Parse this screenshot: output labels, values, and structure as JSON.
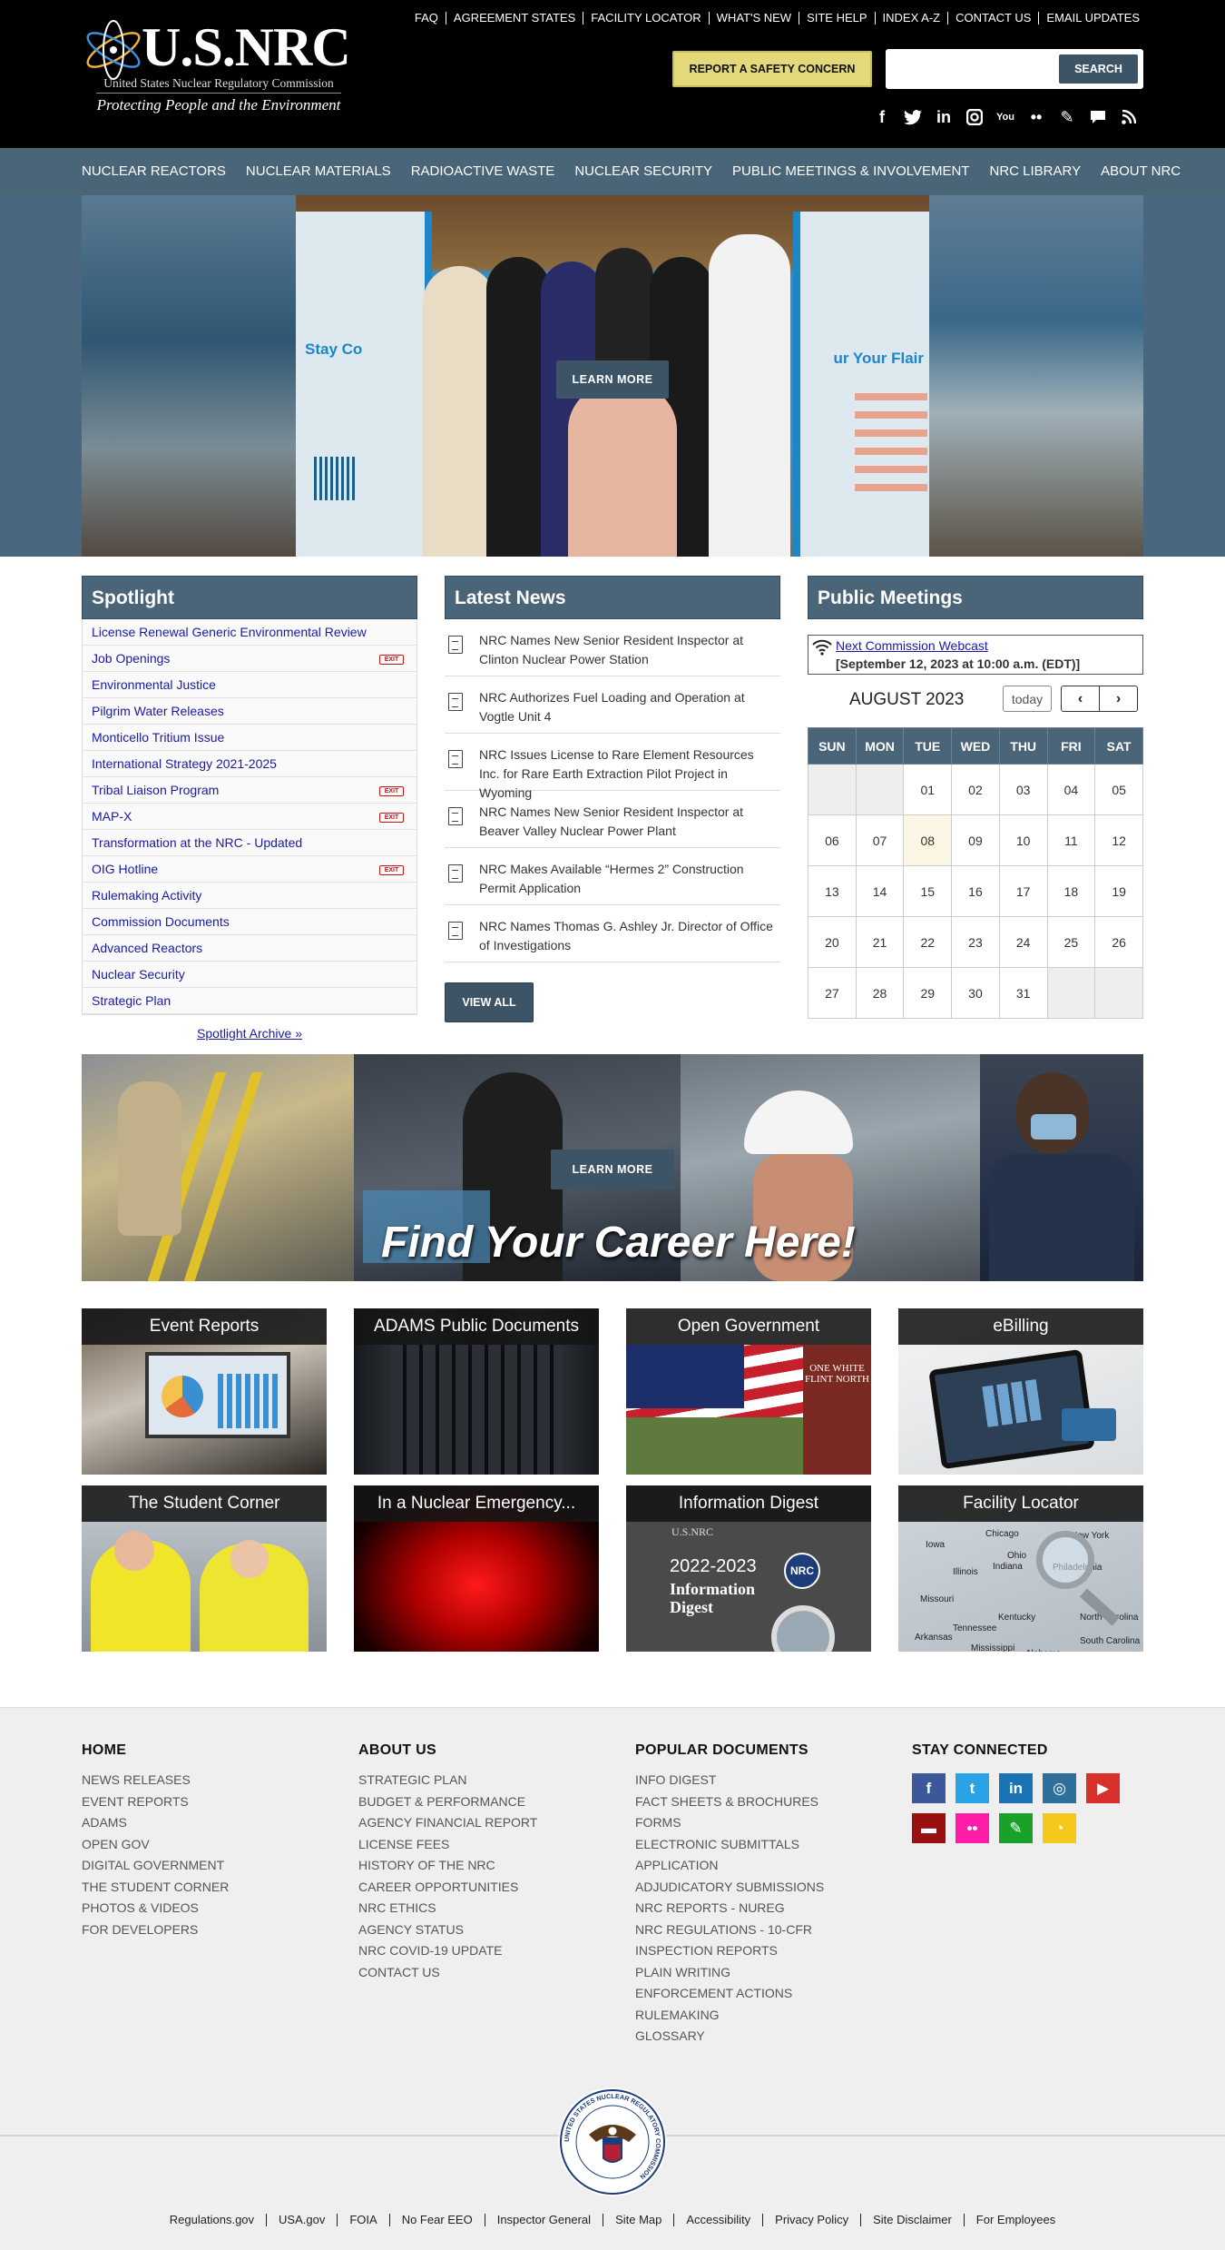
{
  "header": {
    "logo_brand": "U.S.NRC",
    "logo_subtitle": "United States Nuclear Regulatory Commission",
    "logo_tagline": "Protecting People and the Environment",
    "util_nav": [
      "FAQ",
      "AGREEMENT STATES",
      "FACILITY LOCATOR",
      "WHAT'S NEW",
      "SITE HELP",
      "INDEX A-Z",
      "CONTACT US",
      "EMAIL UPDATES"
    ],
    "report_label": "REPORT A SAFETY CONCERN",
    "search_value": "",
    "search_label": "SEARCH",
    "social_icons": [
      "facebook-icon",
      "twitter-icon",
      "linkedin-icon",
      "instagram-icon",
      "youtube-icon",
      "flickr-icon",
      "pencil-icon",
      "comment-icon",
      "rss-icon"
    ]
  },
  "main_nav": [
    "NUCLEAR REACTORS",
    "NUCLEAR MATERIALS",
    "RADIOACTIVE WASTE",
    "NUCLEAR SECURITY",
    "PUBLIC MEETINGS & INVOLVEMENT",
    "NRC LIBRARY",
    "ABOUT NRC"
  ],
  "hero": {
    "banner_left_text": "Stay Co",
    "banner_right_text": "ur Your Flair",
    "learn_more": "LEARN MORE"
  },
  "spotlight": {
    "title": "Spotlight",
    "items": [
      {
        "label": "License Renewal Generic Environmental Review",
        "exit": false
      },
      {
        "label": "Job Openings",
        "exit": true
      },
      {
        "label": "Environmental Justice",
        "exit": false
      },
      {
        "label": "Pilgrim Water Releases",
        "exit": false
      },
      {
        "label": "Monticello Tritium Issue",
        "exit": false
      },
      {
        "label": "International Strategy 2021-2025",
        "exit": false
      },
      {
        "label": "Tribal Liaison Program",
        "exit": true
      },
      {
        "label": "MAP-X",
        "exit": true
      },
      {
        "label": "Transformation at the NRC - Updated",
        "exit": false
      },
      {
        "label": "OIG Hotline",
        "exit": true
      },
      {
        "label": "Rulemaking Activity",
        "exit": false
      },
      {
        "label": "Commission Documents",
        "exit": false
      },
      {
        "label": "Advanced Reactors",
        "exit": false
      },
      {
        "label": "Nuclear Security",
        "exit": false
      },
      {
        "label": "Strategic Plan",
        "exit": false
      }
    ],
    "exit_label": "EXIT",
    "archive_label": "Spotlight Archive »"
  },
  "news": {
    "title": "Latest News",
    "items": [
      "NRC Names New Senior Resident Inspector at Clinton Nuclear Power Station",
      "NRC Authorizes Fuel Loading and Operation at Vogtle Unit 4",
      "NRC Issues License to Rare Element Resources Inc. for Rare Earth Extraction Pilot Project in Wyoming",
      "NRC Names New Senior Resident Inspector at Beaver Valley Nuclear Power Plant",
      "NRC Makes Available “Hermes 2” Construction Permit Application",
      "NRC Names Thomas G. Ashley Jr. Director of Office of Investigations"
    ],
    "view_all": "VIEW ALL"
  },
  "meetings": {
    "title": "Public Meetings",
    "webcast_link": "Next Commission Webcast",
    "webcast_date": "[September 12, 2023 at 10:00 a.m. (EDT)]",
    "month": "AUGUST 2023",
    "today_label": "today",
    "prev_label": "‹",
    "next_label": "›",
    "weekdays": [
      "SUN",
      "MON",
      "TUE",
      "WED",
      "THU",
      "FRI",
      "SAT"
    ],
    "weeks": [
      [
        "",
        "",
        "01",
        "02",
        "03",
        "04",
        "05"
      ],
      [
        "06",
        "07",
        "08",
        "09",
        "10",
        "11",
        "12"
      ],
      [
        "13",
        "14",
        "15",
        "16",
        "17",
        "18",
        "19"
      ],
      [
        "20",
        "21",
        "22",
        "23",
        "24",
        "25",
        "26"
      ],
      [
        "27",
        "28",
        "29",
        "30",
        "31",
        "",
        ""
      ]
    ],
    "today_day": "08"
  },
  "career": {
    "learn_more": "LEARN MORE",
    "title": "Find Your Career Here!"
  },
  "tiles": [
    "Event Reports",
    "ADAMS Public Documents",
    "Open Government",
    "eBilling",
    "The Student Corner",
    "In a Nuclear Emergency...",
    "Information Digest",
    "Facility Locator"
  ],
  "tile_art": {
    "owf_text": "ONE WHITE FLINT NORTH",
    "digest_year": "2022-2023",
    "digest_title": "Information Digest",
    "digest_brand": "U.S.NRC",
    "nrc_badge": "NRC",
    "map_labels": [
      "Iowa",
      "Illinois",
      "Indiana",
      "Ohio",
      "New York",
      "Missouri",
      "Kentucky",
      "Tennessee",
      "Arkansas",
      "Mississippi",
      "Alabama",
      "North Carolina",
      "South Carolina",
      "Philadelphia",
      "Chicago"
    ]
  },
  "footer": {
    "columns": [
      {
        "heading": "HOME",
        "links": [
          "NEWS RELEASES",
          "EVENT REPORTS",
          "ADAMS",
          "OPEN GOV",
          "DIGITAL GOVERNMENT",
          "THE STUDENT CORNER",
          "PHOTOS & VIDEOS",
          "FOR DEVELOPERS"
        ]
      },
      {
        "heading": "ABOUT US",
        "links": [
          "STRATEGIC PLAN",
          "BUDGET & PERFORMANCE",
          "AGENCY FINANCIAL REPORT",
          "LICENSE FEES",
          "HISTORY OF THE NRC",
          "CAREER OPPORTUNITIES",
          "NRC ETHICS",
          "AGENCY STATUS",
          "NRC COVID-19 UPDATE",
          "CONTACT US"
        ]
      },
      {
        "heading": "POPULAR DOCUMENTS",
        "links": [
          "INFO DIGEST",
          "FACT SHEETS & BROCHURES",
          "FORMS",
          "ELECTRONIC SUBMITTALS",
          "APPLICATION",
          "ADJUDICATORY SUBMISSIONS",
          "NRC REPORTS - NUREG",
          "NRC REGULATIONS - 10-CFR",
          "INSPECTION REPORTS",
          "PLAIN WRITING",
          "ENFORCEMENT ACTIONS",
          "RULEMAKING",
          "GLOSSARY"
        ]
      },
      {
        "heading": "STAY CONNECTED",
        "links": []
      }
    ],
    "social": [
      {
        "name": "facebook-icon",
        "glyph": "f",
        "color": "#3b5998"
      },
      {
        "name": "twitter-icon",
        "glyph": "t",
        "color": "#2aa3e6"
      },
      {
        "name": "linkedin-icon",
        "glyph": "in",
        "color": "#1a73b4"
      },
      {
        "name": "instagram-icon",
        "glyph": "◎",
        "color": "#2f6f9c"
      },
      {
        "name": "youtube-icon",
        "glyph": "▶",
        "color": "#d8302a"
      },
      {
        "name": "comment-icon",
        "glyph": "▬",
        "color": "#9a1010"
      },
      {
        "name": "flickr-icon",
        "glyph": "••",
        "color": "#ff1da8"
      },
      {
        "name": "pencil-icon",
        "glyph": "✎",
        "color": "#1aa12a"
      },
      {
        "name": "rss-icon",
        "glyph": "◔",
        "color": "#f5c81a"
      }
    ],
    "seal_text": "UNITED STATES NUCLEAR REGULATORY COMMISSION",
    "legal_links": [
      "Regulations.gov",
      "USA.gov",
      "FOIA",
      "No Fear EEO",
      "Inspector General",
      "Site Map",
      "Accessibility",
      "Privacy Policy",
      "Site Disclaimer",
      "For Employees"
    ]
  }
}
